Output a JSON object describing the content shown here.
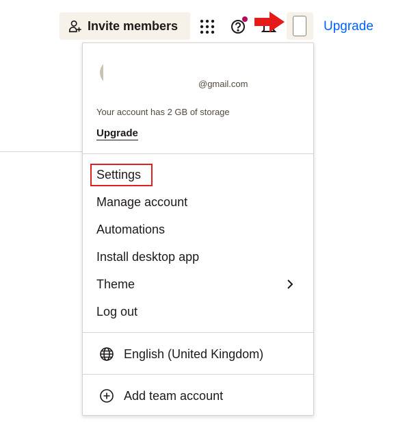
{
  "header": {
    "invite_label": "Invite members",
    "upgrade_label": "Upgrade",
    "icons": [
      "person-add-icon",
      "apps-grid-icon",
      "help-icon",
      "bell-icon",
      "avatar"
    ]
  },
  "menu": {
    "email": "@gmail.com",
    "storage_text": "Your account has 2 GB of storage",
    "upgrade_label": "Upgrade",
    "items": [
      {
        "label": "Settings"
      },
      {
        "label": "Manage account"
      },
      {
        "label": "Automations"
      },
      {
        "label": "Install desktop app"
      },
      {
        "label": "Theme"
      },
      {
        "label": "Log out"
      }
    ],
    "language": "English (United Kingdom)",
    "add_team": "Add team account"
  },
  "colors": {
    "accent_blue": "#0061fe",
    "highlight_red": "#e02020",
    "button_bg": "#f7f2e9",
    "notification_dot": "#b3095b"
  }
}
